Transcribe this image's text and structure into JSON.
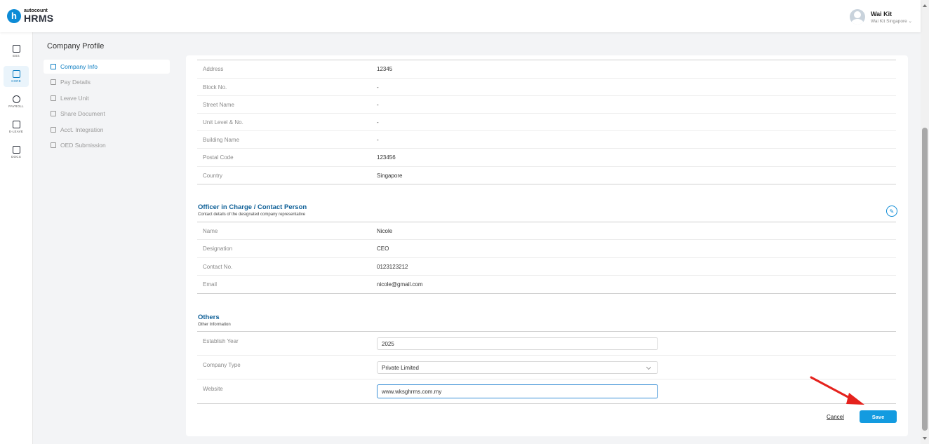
{
  "header": {
    "logo_badge": "h",
    "logo_small": "autocount",
    "logo_big": "HRMS",
    "user_name": "Wai Kit",
    "user_company": "Wai Kit Singapore ⌄"
  },
  "rail": [
    {
      "label": "ESS",
      "icon": "ess-icon"
    },
    {
      "label": "CORE",
      "icon": "core-icon"
    },
    {
      "label": "PAYROLL",
      "icon": "payroll-icon"
    },
    {
      "label": "E-LEAVE",
      "icon": "calendar-icon"
    },
    {
      "label": "DOCS",
      "icon": "docs-icon"
    }
  ],
  "subnav": {
    "title": "Company Profile",
    "items": [
      {
        "label": "Company Info"
      },
      {
        "label": "Pay Details"
      },
      {
        "label": "Leave Unit"
      },
      {
        "label": "Share Document"
      },
      {
        "label": "Acct. Integration"
      },
      {
        "label": "OED Submission"
      }
    ]
  },
  "address": {
    "rows": [
      {
        "label": "Address",
        "value": "12345"
      },
      {
        "label": "Block No.",
        "value": "-"
      },
      {
        "label": "Street Name",
        "value": "-"
      },
      {
        "label": "Unit Level & No.",
        "value": "-"
      },
      {
        "label": "Building Name",
        "value": "-"
      },
      {
        "label": "Postal Code",
        "value": "123456"
      },
      {
        "label": "Country",
        "value": "Singapore"
      }
    ]
  },
  "officer": {
    "title": "Officer in Charge / Contact Person",
    "subtitle": "Contact details of the designated company representative",
    "rows": [
      {
        "label": "Name",
        "value": "Nicole"
      },
      {
        "label": "Designation",
        "value": "CEO"
      },
      {
        "label": "Contact No.",
        "value": "0123123212"
      },
      {
        "label": "Email",
        "value": "nicole@gmail.com"
      }
    ]
  },
  "others": {
    "title": "Others",
    "subtitle": "Other Information",
    "establish_label": "Establish Year",
    "establish_value": "2025",
    "company_type_label": "Company Type",
    "company_type_value": "Private Limited",
    "website_label": "Website",
    "website_value": "www.wksghrms.com.my"
  },
  "actions": {
    "cancel": "Cancel",
    "save": "Save"
  },
  "colors": {
    "accent": "#139be0",
    "section_title": "#0d5f97",
    "arrow": "#e5221d"
  }
}
